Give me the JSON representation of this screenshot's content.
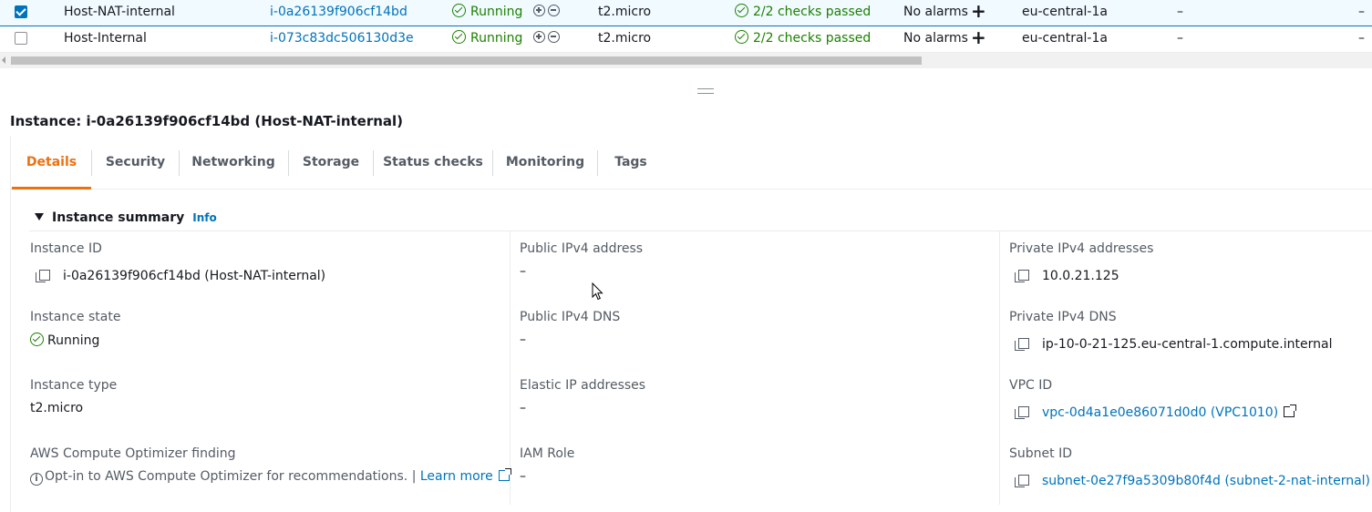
{
  "rows": [
    {
      "selected": true,
      "name": "Host-NAT-internal",
      "instance_id": "i-0a26139f906cf14bd",
      "state": "Running",
      "type": "t2.micro",
      "checks": "2/2 checks passed",
      "alarms": "No alarms",
      "az": "eu-central-1a",
      "col9": "–",
      "col10": "–"
    },
    {
      "selected": false,
      "name": "Host-Internal",
      "instance_id": "i-073c83dc506130d3e",
      "state": "Running",
      "type": "t2.micro",
      "checks": "2/2 checks passed",
      "alarms": "No alarms",
      "az": "eu-central-1a",
      "col9": "–",
      "col10": "–"
    }
  ],
  "detail": {
    "title": "Instance: i-0a26139f906cf14bd (Host-NAT-internal)",
    "tabs": [
      "Details",
      "Security",
      "Networking",
      "Storage",
      "Status checks",
      "Monitoring",
      "Tags"
    ],
    "active_tab": "Details",
    "summary_title": "Instance summary",
    "summary_info": "Info",
    "col1": {
      "instance_id_label": "Instance ID",
      "instance_id_value": "i-0a26139f906cf14bd (Host-NAT-internal)",
      "state_label": "Instance state",
      "state_value": "Running",
      "type_label": "Instance type",
      "type_value": "t2.micro",
      "optimizer_label": "AWS Compute Optimizer finding",
      "optimizer_text": "Opt-in to AWS Compute Optimizer for recommendations. |",
      "optimizer_link": "Learn more"
    },
    "col2": {
      "public_ip_label": "Public IPv4 address",
      "public_ip_value": "–",
      "public_dns_label": "Public IPv4 DNS",
      "public_dns_value": "–",
      "elastic_label": "Elastic IP addresses",
      "elastic_value": "–",
      "iam_label": "IAM Role",
      "iam_value": "–"
    },
    "col3": {
      "private_ip_label": "Private IPv4 addresses",
      "private_ip_value": "10.0.21.125",
      "private_dns_label": "Private IPv4 DNS",
      "private_dns_value": "ip-10-0-21-125.eu-central-1.compute.internal",
      "vpc_label": "VPC ID",
      "vpc_value": "vpc-0d4a1e0e86071d0d0 (VPC1010)",
      "subnet_label": "Subnet ID",
      "subnet_value": "subnet-0e27f9a5309b80f4d (subnet-2-nat-internal)"
    }
  },
  "colors": {
    "link": "#0073bb",
    "success": "#1d8102",
    "active_tab": "#ec7211"
  }
}
